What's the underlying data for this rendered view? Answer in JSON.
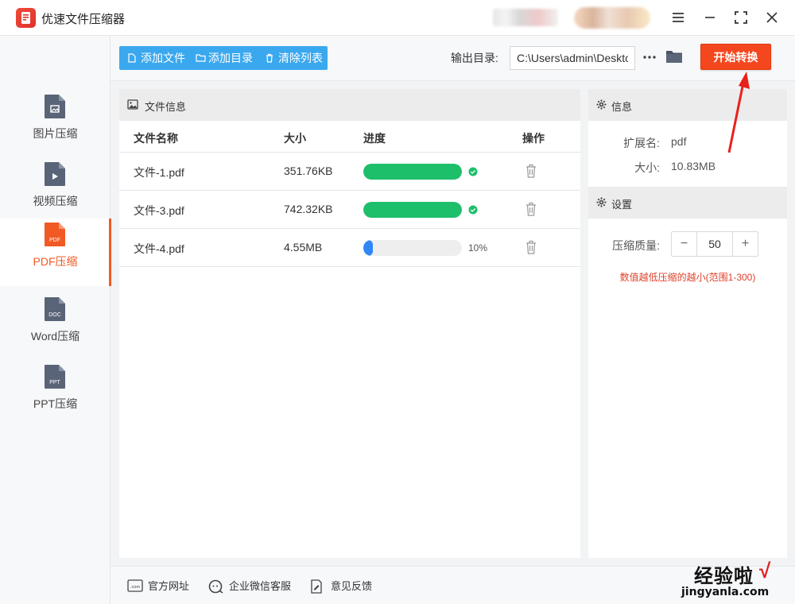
{
  "app": {
    "title": "优速文件压缩器"
  },
  "sidebar": {
    "items": [
      {
        "label": "图片压缩",
        "icon": "image-file-icon",
        "active": false
      },
      {
        "label": "视频压缩",
        "icon": "video-file-icon",
        "active": false
      },
      {
        "label": "PDF压缩",
        "icon": "pdf-file-icon",
        "badge": "PDF",
        "active": true
      },
      {
        "label": "Word压缩",
        "icon": "doc-file-icon",
        "badge": "DOC",
        "active": false
      },
      {
        "label": "PPT压缩",
        "icon": "ppt-file-icon",
        "badge": "PPT",
        "active": false
      }
    ]
  },
  "toolbar": {
    "add_file": "添加文件",
    "add_folder": "添加目录",
    "clear_list": "清除列表",
    "output_label": "输出目录:",
    "output_path": "C:\\Users\\admin\\Desktop",
    "start_button": "开始转换"
  },
  "file_panel": {
    "title": "文件信息",
    "columns": {
      "name": "文件名称",
      "size": "大小",
      "progress": "进度",
      "action": "操作"
    },
    "rows": [
      {
        "name": "文件-1.pdf",
        "size": "351.76KB",
        "progress": 1.0,
        "status": "done",
        "progress_text": ""
      },
      {
        "name": "文件-3.pdf",
        "size": "742.32KB",
        "progress": 1.0,
        "status": "done",
        "progress_text": ""
      },
      {
        "name": "文件-4.pdf",
        "size": "4.55MB",
        "progress": 0.1,
        "status": "running",
        "progress_text": "10%"
      }
    ]
  },
  "info_panel": {
    "info_title": "信息",
    "ext_label": "扩展名:",
    "ext_value": "pdf",
    "size_label": "大小:",
    "size_value": "10.83MB",
    "settings_title": "设置",
    "quality_label": "压缩质量:",
    "quality_value": "50",
    "hint": "数值越低压缩的越小(范围1-300)"
  },
  "footer": {
    "website": "官方网址",
    "wechat": "企业微信客服",
    "feedback": "意见反馈"
  },
  "watermark": {
    "main": "经验啦",
    "check": "√",
    "sub": "jingyanla.com"
  },
  "colors": {
    "accent": "#f15a24",
    "toolbar_blue": "#3aa8ef",
    "start_button": "#f4471e",
    "progress_done": "#1dbf6a",
    "progress_running": "#2f86f6",
    "hint_red": "#e0402a"
  }
}
